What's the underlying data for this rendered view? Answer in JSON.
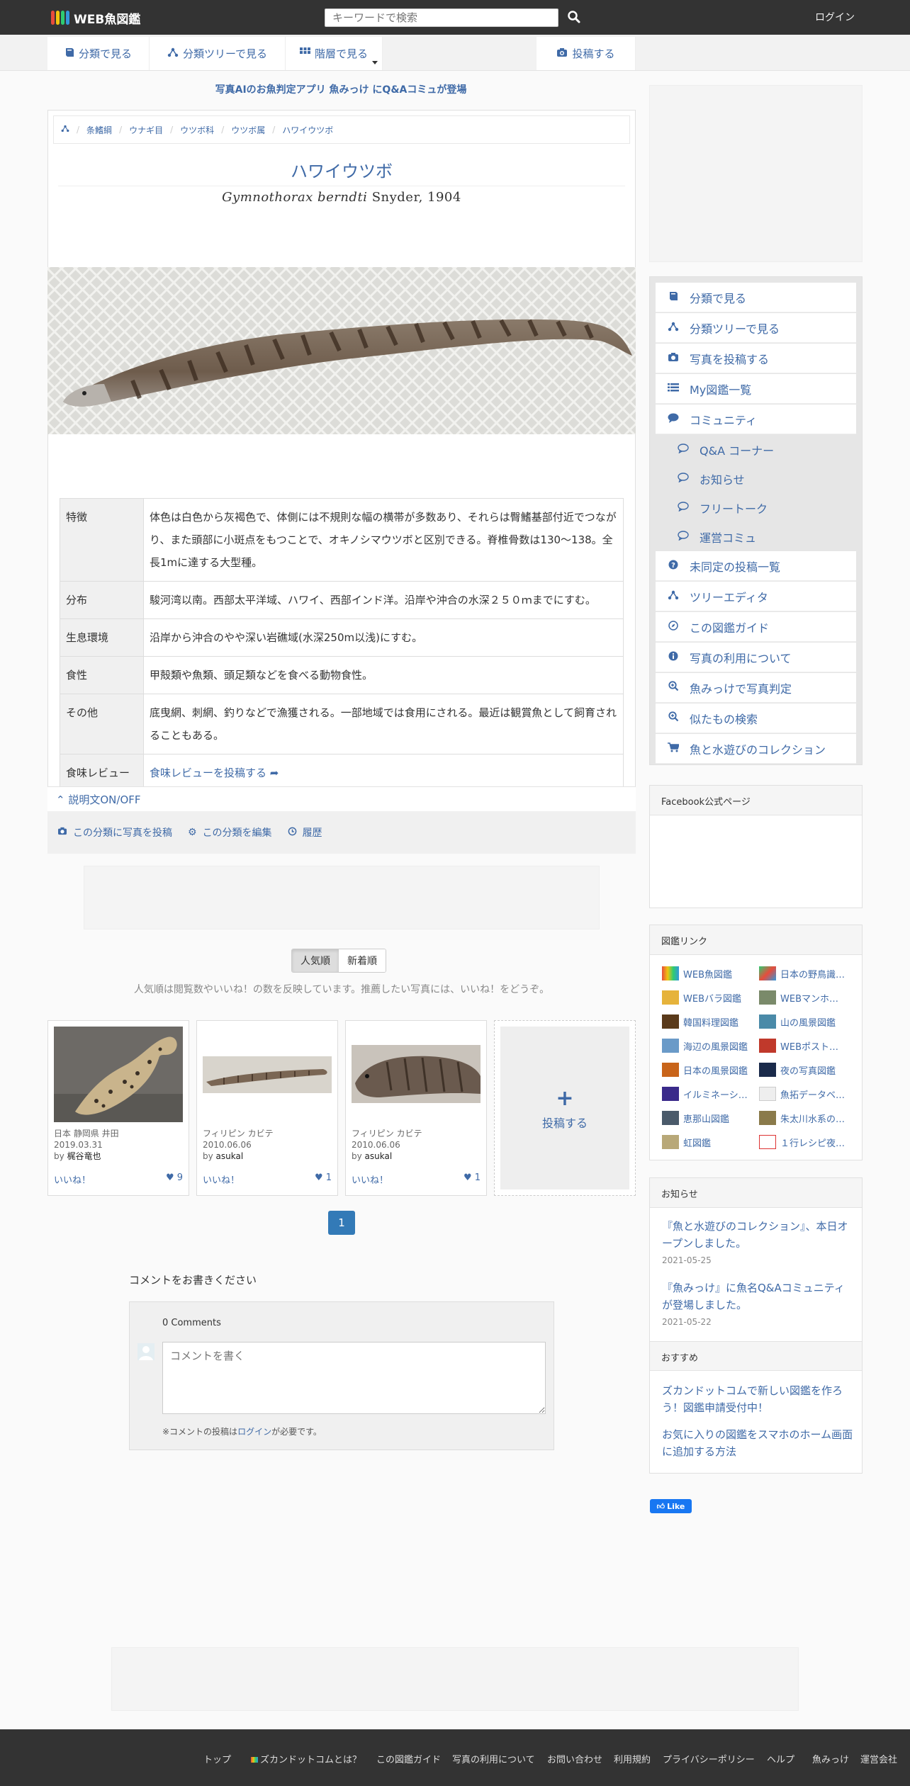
{
  "header": {
    "app_name": "WEB魚図鑑",
    "search_placeholder": "キーワードで検索",
    "login_label": "ログイン"
  },
  "nav": {
    "tabs": [
      "分類で見る",
      "分類ツリーで見る",
      "階層で見る"
    ],
    "post_label": "投稿する"
  },
  "announcement": "写真AIのお魚判定アプリ 魚みっけ にQ&Aコミュが登場",
  "breadcrumb": [
    "条鰭綱",
    "ウナギ目",
    "ウツボ科",
    "ウツボ属",
    "ハワイウツボ"
  ],
  "species": {
    "japanese_name": "ハワイウツボ",
    "scientific_name": "Gymnothorax berndti",
    "author": "Snyder, 1904"
  },
  "info_table": [
    {
      "key": "特徴",
      "value": "体色は白色から灰褐色で、体側には不規則な幅の横帯が多数あり、それらは臀鰭基部付近でつながり、また頭部に小斑点をもつことで、オキノシマウツボと区別できる。脊椎骨数は130～138。全長1mに達する大型種。"
    },
    {
      "key": "分布",
      "value": "駿河湾以南。西部太平洋域、ハワイ、西部インド洋。沿岸や沖合の水深２５０ｍまでにすむ。"
    },
    {
      "key": "生息環境",
      "value": "沿岸から沖合のやや深い岩礁域(水深250m以浅)にすむ。"
    },
    {
      "key": "食性",
      "value": "甲殻類や魚類、頭足類などを食べる動物食性。"
    },
    {
      "key": "その他",
      "value": "底曳網、刺網、釣りなどで漁獲される。一部地域では食用にされる。最近は観賞魚として飼育されることもある。"
    },
    {
      "key": "食味レビュー",
      "value": "食味レビューを投稿する"
    }
  ],
  "toggle_label": "説明文ON/OFF",
  "actions": [
    "この分類に写真を投稿",
    "この分類を編集",
    "履歴"
  ],
  "sort": {
    "options": [
      "人気順",
      "新着順"
    ],
    "note": "人気順は閲覧数やいいね！の数を反映しています。推薦したい写真には、いいね！をどうぞ。"
  },
  "photos": [
    {
      "location": "日本 静岡県 井田",
      "date": "2019.03.31",
      "by": "by",
      "user": "梶谷竜也",
      "like": "いいね！",
      "count": "♥ 9"
    },
    {
      "location": "フィリピン カビテ",
      "date": "2010.06.06",
      "by": "by",
      "user": "asukal",
      "like": "いいね！",
      "count": "♥ 1"
    },
    {
      "location": "フィリピン カビテ",
      "date": "2010.06.06",
      "by": "by",
      "user": "asukal",
      "like": "いいね！",
      "count": "♥ 1"
    }
  ],
  "post_tile": {
    "plus": "+",
    "label": "投稿する"
  },
  "pagination": {
    "current": "1"
  },
  "comments": {
    "title": "コメントをお書きください",
    "count": "0 Comments",
    "placeholder": "コメントを書く",
    "note_prefix": "※コメントの投稿は",
    "note_link": "ログイン",
    "note_suffix": "が必要です。"
  },
  "sidebar": {
    "menu": [
      {
        "label": "分類で見る",
        "icon": "book-icon"
      },
      {
        "label": "分類ツリーで見る",
        "icon": "tree-icon"
      },
      {
        "label": "写真を投稿する",
        "icon": "camera-icon"
      },
      {
        "label": "My図鑑一覧",
        "icon": "list-icon"
      },
      {
        "label": "コミュニティ",
        "icon": "comment-icon"
      },
      {
        "label": "Q&A コーナー",
        "icon": "chat-icon"
      },
      {
        "label": "お知らせ",
        "icon": "chat-icon"
      },
      {
        "label": "フリートーク",
        "icon": "chat-icon"
      },
      {
        "label": "運営コミュ",
        "icon": "chat-icon"
      },
      {
        "label": "未同定の投稿一覧",
        "icon": "question-icon"
      },
      {
        "label": "ツリーエディタ",
        "icon": "tree-icon"
      },
      {
        "label": "この図鑑ガイド",
        "icon": "compass-icon"
      },
      {
        "label": "写真の利用について",
        "icon": "info-icon"
      },
      {
        "label": "魚みっけで写真判定",
        "icon": "zoom-icon"
      },
      {
        "label": "似たもの検索",
        "icon": "zoom-icon"
      },
      {
        "label": "魚と水遊びのコレクション",
        "icon": "cart-icon"
      }
    ],
    "facebook_title": "Facebook公式ページ",
    "links_title": "図鑑リンク",
    "links": [
      "WEB魚図鑑",
      "日本の野鳥識…",
      "WEBバラ図鑑",
      "WEBマンホ…",
      "韓国料理図鑑",
      "山の風景図鑑",
      "海辺の風景図鑑",
      "WEBポスト…",
      "日本の風景図鑑",
      "夜の写真図鑑",
      "イルミネーシ…",
      "魚拓データベ…",
      "恵那山図鑑",
      "朱太川水系の…",
      "虹図鑑",
      "１行レシピ夜…"
    ],
    "news_title": "お知らせ",
    "news": [
      {
        "text": "『魚と水遊びのコレクション』、本日オープンしました。",
        "date": "2021-05-25"
      },
      {
        "text": "『魚みっけ』に魚名Q&Aコミュニティが登場しました。",
        "date": "2021-05-22"
      }
    ],
    "recommend_title": "おすすめ",
    "recommend": [
      "ズカンドットコムで新しい図鑑を作ろう！図鑑申請受付中！",
      "お気に入りの図鑑をスマホのホーム画面に追加する方法"
    ],
    "fb_like": "Like"
  },
  "footer": [
    "トップ",
    "ズカンドットコムとは？",
    "この図鑑ガイド",
    "写真の利用について",
    "お問い合わせ",
    "利用規約",
    "プライバシーポリシー",
    "ヘルプ",
    "魚みっけ",
    "運営会社"
  ],
  "colors": {
    "accent": "#3f6aa7",
    "topbar": "#333333",
    "page_button": "#337ab7"
  }
}
